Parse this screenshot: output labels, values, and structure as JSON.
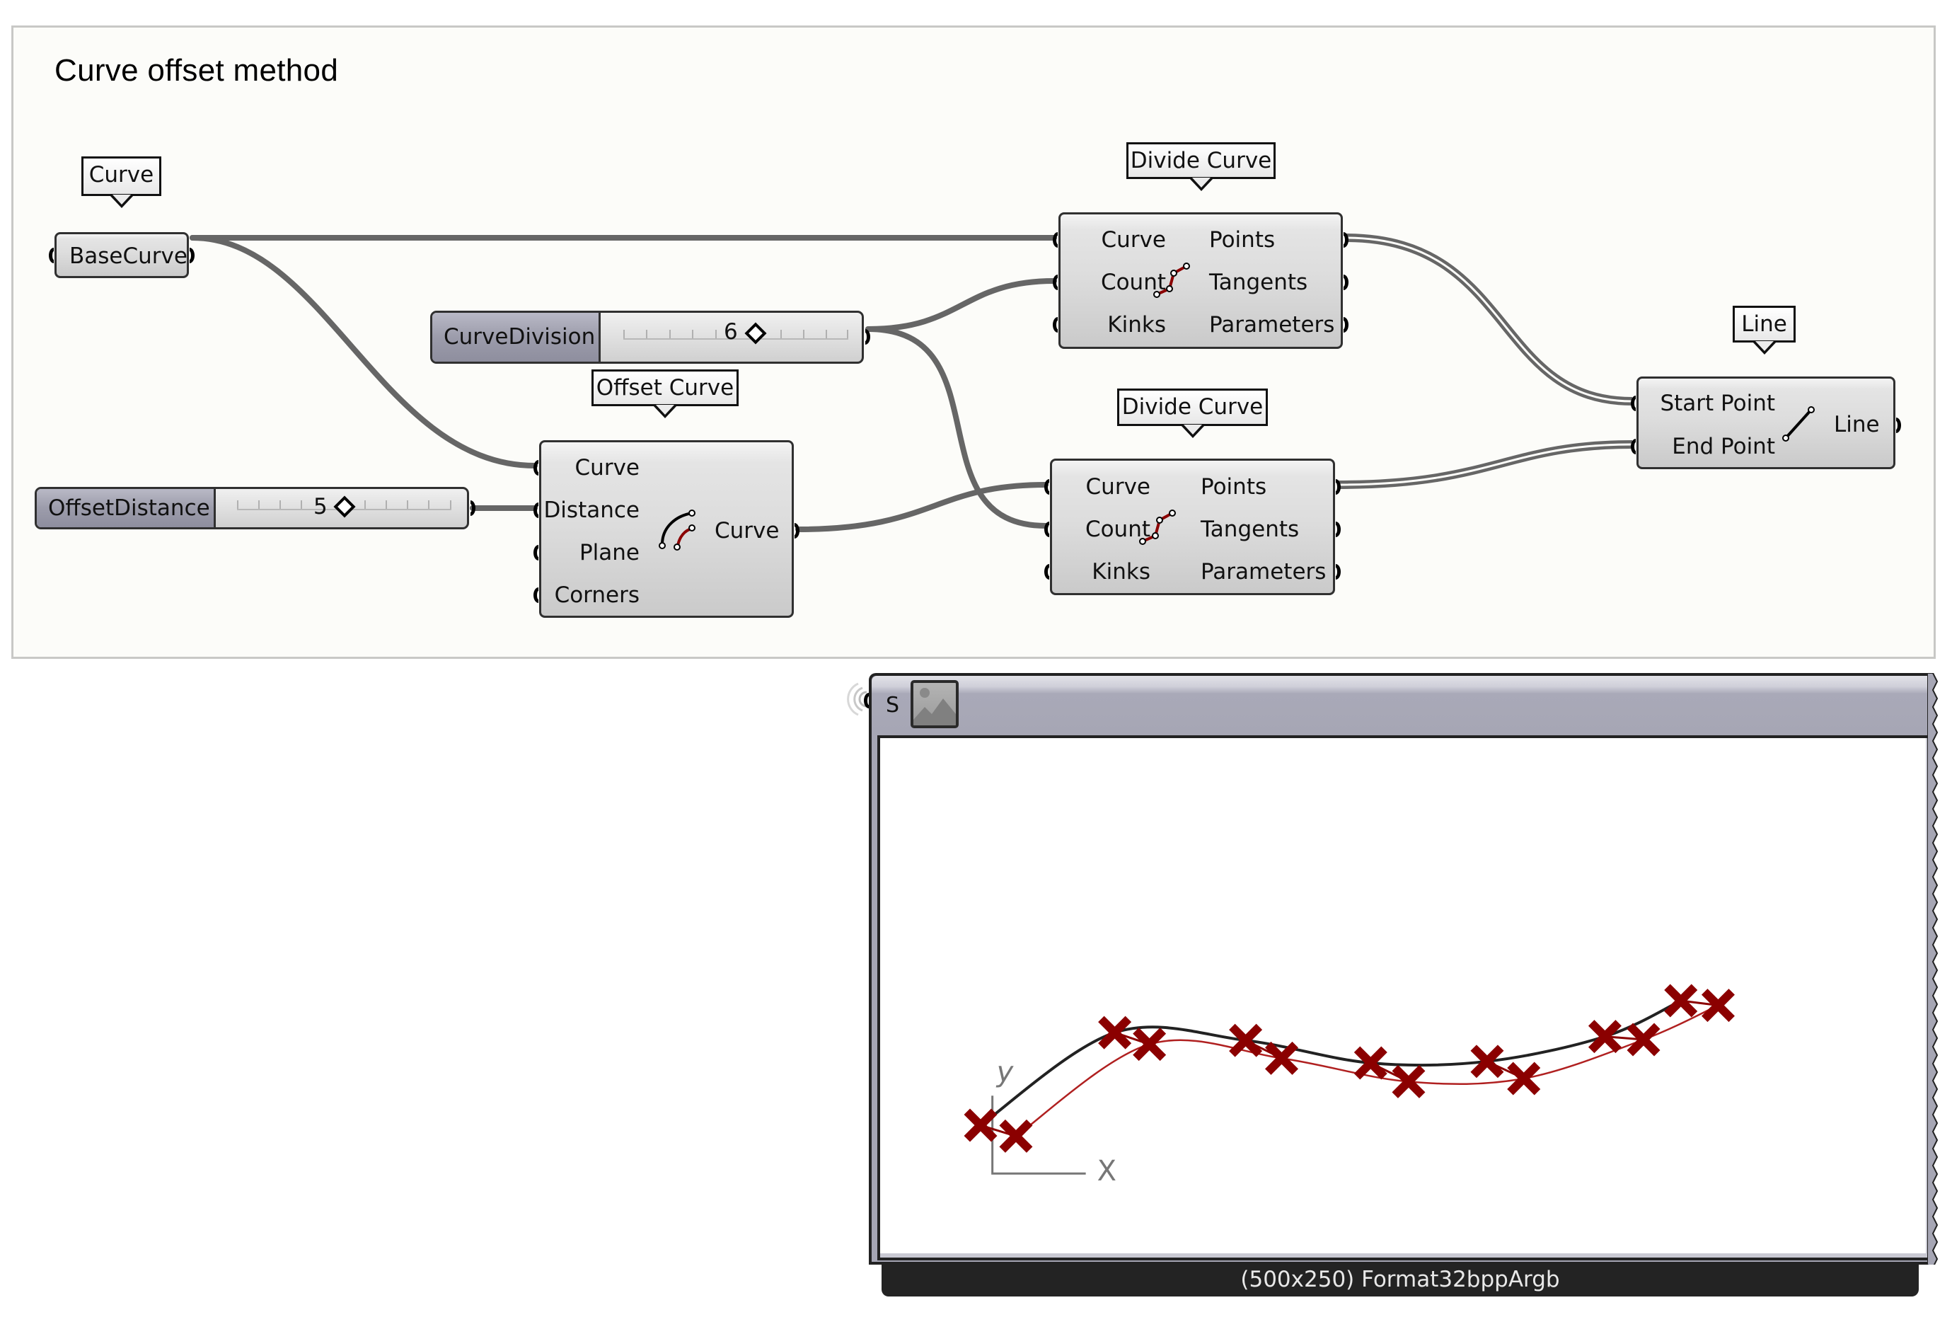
{
  "group": {
    "title": "Curve offset method"
  },
  "params": {
    "base_curve": {
      "tooltip": "Curve",
      "name": "BaseCurve"
    }
  },
  "sliders": {
    "curve_division": {
      "name": "CurveDivision",
      "value": "6",
      "value_fraction": 0.5
    },
    "offset_distance": {
      "name": "OffsetDistance",
      "value": "5",
      "value_fraction": 0.5
    }
  },
  "components": {
    "offset_curve": {
      "tooltip": "Offset Curve",
      "inputs": [
        "Curve",
        "Distance",
        "Plane",
        "Corners"
      ],
      "outputs": [
        "Curve"
      ],
      "icon": "offset-curve-icon"
    },
    "divide_curve_1": {
      "tooltip": "Divide Curve",
      "inputs": [
        "Curve",
        "Count",
        "Kinks"
      ],
      "outputs": [
        "Points",
        "Tangents",
        "Parameters"
      ],
      "icon": "divide-curve-icon"
    },
    "divide_curve_2": {
      "tooltip": "Divide Curve",
      "inputs": [
        "Curve",
        "Count",
        "Kinks"
      ],
      "outputs": [
        "Points",
        "Tangents",
        "Parameters"
      ],
      "icon": "divide-curve-icon"
    },
    "line": {
      "tooltip": "Line",
      "inputs": [
        "Start Point",
        "End Point"
      ],
      "outputs": [
        "Line"
      ],
      "icon": "line-icon"
    }
  },
  "image_panel": {
    "input_label": "S",
    "thumbnail_icon": "image-icon",
    "footer": "(500x250) Format32bppArgb",
    "preview": {
      "axis_labels": {
        "x": "X",
        "y": "y"
      },
      "base_points": [
        [
          0,
          0.75
        ],
        [
          0.205,
          0.155
        ],
        [
          0.405,
          0.205
        ],
        [
          0.596,
          0.35
        ],
        [
          0.774,
          0.34
        ],
        [
          0.954,
          0.18
        ],
        [
          1.07,
          -0.05
        ]
      ],
      "offset_points": [
        [
          0.054,
          0.82
        ],
        [
          0.258,
          0.23
        ],
        [
          0.46,
          0.32
        ],
        [
          0.654,
          0.47
        ],
        [
          0.83,
          0.45
        ],
        [
          1.013,
          0.2
        ],
        [
          1.127,
          -0.02
        ]
      ],
      "colors": {
        "base_curve": "#222222",
        "offset_curve": "#b02020",
        "markers": "#8b0000"
      }
    }
  },
  "wires": [
    {
      "from": "BaseCurve",
      "to": "Divide Curve 1.Curve"
    },
    {
      "from": "BaseCurve",
      "to": "Offset Curve.Curve"
    },
    {
      "from": "CurveDivision",
      "to": "Divide Curve 1.Count"
    },
    {
      "from": "CurveDivision",
      "to": "Divide Curve 2.Count"
    },
    {
      "from": "OffsetDistance",
      "to": "Offset Curve.Distance"
    },
    {
      "from": "Offset Curve.Curve",
      "to": "Divide Curve 2.Curve"
    },
    {
      "from": "Divide Curve 1.Points",
      "to": "Line.Start Point"
    },
    {
      "from": "Divide Curve 2.Points",
      "to": "Line.End Point"
    }
  ]
}
